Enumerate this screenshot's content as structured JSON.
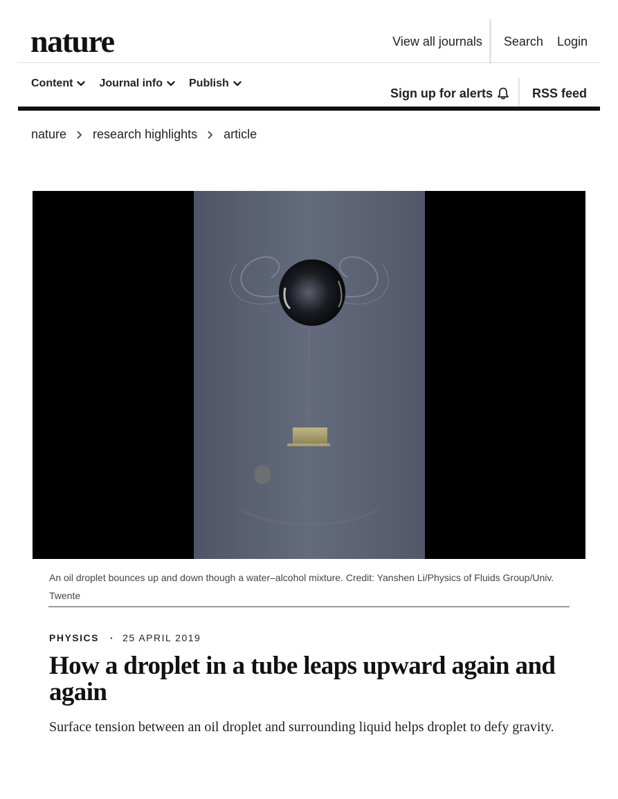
{
  "header": {
    "logo": "nature",
    "links": {
      "view_all_journals": "View all journals",
      "search": "Search",
      "login": "Login"
    }
  },
  "nav": {
    "items": [
      {
        "label": "Content"
      },
      {
        "label": "Journal info"
      },
      {
        "label": "Publish"
      }
    ],
    "alerts": "Sign up for alerts",
    "rss": "RSS feed"
  },
  "breadcrumb": {
    "items": [
      "nature",
      "research highlights",
      "article"
    ]
  },
  "figure": {
    "caption": "An oil droplet bounces up and down though a water–alcohol mixture. Credit: Yanshen Li/Physics of Fluids Group/Univ. Twente"
  },
  "article": {
    "subject": "PHYSICS",
    "separator": "·",
    "date": "25 APRIL 2019",
    "title": "How a droplet in a tube leaps upward again and again",
    "standfirst": "Surface tension between an oil droplet and surrounding liquid helps droplet to defy gravity."
  },
  "colors": {
    "text": "#222222",
    "rule_thick": "#111111",
    "rule_light": "#dcdcdc",
    "hero_bg": "#000000",
    "tube": "#5b6173"
  },
  "icons": [
    "chevron-down-icon",
    "bell-icon",
    "chevron-right-icon"
  ]
}
